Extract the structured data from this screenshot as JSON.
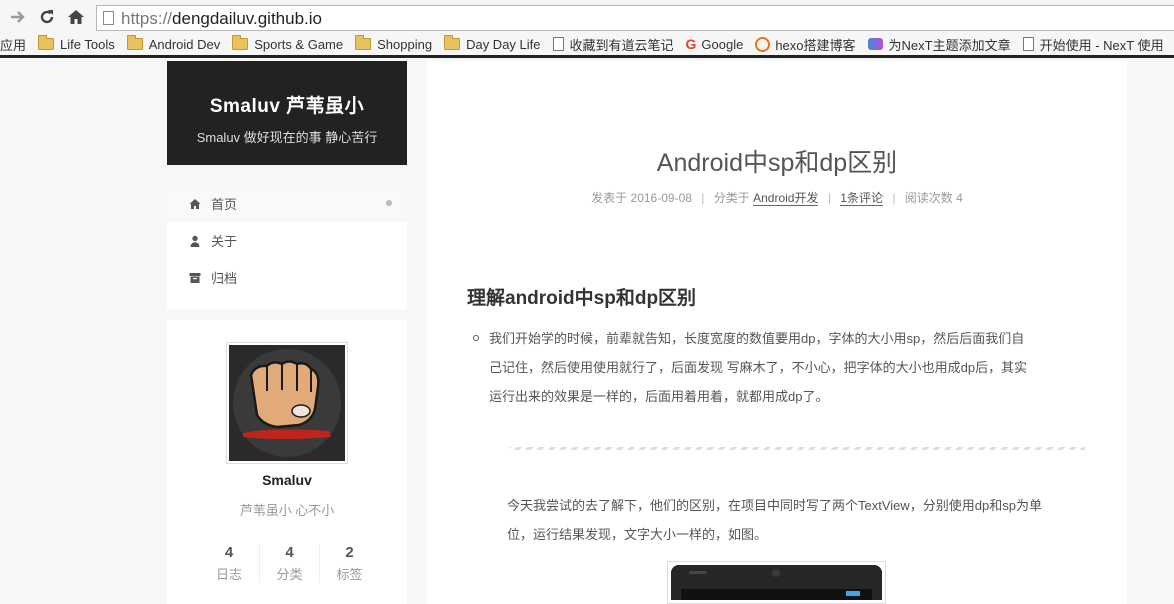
{
  "browser": {
    "url_scheme": "https://",
    "url_host": "dengdailuv.github.io",
    "bookmarks": [
      {
        "label": "应用",
        "icon": "apps-icon"
      },
      {
        "label": "Life Tools",
        "icon": "folder-icon"
      },
      {
        "label": "Android Dev",
        "icon": "folder-icon"
      },
      {
        "label": "Sports & Game",
        "icon": "folder-icon"
      },
      {
        "label": "Shopping",
        "icon": "folder-icon"
      },
      {
        "label": "Day Day Life",
        "icon": "folder-icon"
      },
      {
        "label": "收藏到有道云笔记",
        "icon": "page-icon"
      },
      {
        "label": "Google",
        "icon": "google-icon"
      },
      {
        "label": "hexo搭建博客",
        "icon": "hexo-icon"
      },
      {
        "label": "为NexT主题添加文章",
        "icon": "next-icon"
      },
      {
        "label": "开始使用 - NexT 使用",
        "icon": "page-icon"
      }
    ]
  },
  "site": {
    "title": "Smaluv 芦苇虽小",
    "subtitle": "Smaluv 做好现在的事 静心苦行"
  },
  "menu": [
    {
      "label": "首页",
      "icon": "home-icon",
      "active": true
    },
    {
      "label": "关于",
      "icon": "user-icon",
      "active": false
    },
    {
      "label": "归档",
      "icon": "archive-icon",
      "active": false
    }
  ],
  "profile": {
    "name": "Smaluv",
    "description": "芦苇虽小 心不小",
    "stats": [
      {
        "count": "4",
        "label": "日志"
      },
      {
        "count": "4",
        "label": "分类"
      },
      {
        "count": "2",
        "label": "标签"
      }
    ]
  },
  "post": {
    "title": "Android中sp和dp区别",
    "meta": {
      "posted_prefix": "发表于",
      "date": "2016-09-08",
      "category_prefix": "分类于",
      "category": "Android开发",
      "comments": "1条评论",
      "views_label": "阅读次数",
      "views": "4"
    },
    "heading": "理解android中sp和dp区别",
    "bullet_lines": [
      "我们开始学的时候，前辈就告知，长度宽度的数值要用dp，字体的大小用sp，然后后面我们自",
      "己记住，然后使用使用就行了，后面发现 写麻木了，不小心，把字体的大小也用成dp后，其实",
      "运行出来的效果是一样的，后面用着用着，就都用成dp了。"
    ],
    "paragraph_lines": [
      "今天我尝试的去了解下，他们的区别，在项目中同时写了两个TextView，分别使用dp和sp为单",
      "位，运行结果发现，文字大小一样的，如图。"
    ]
  },
  "colors": {
    "header_bg": "#222222",
    "page_bg": "#f5f7f9"
  }
}
